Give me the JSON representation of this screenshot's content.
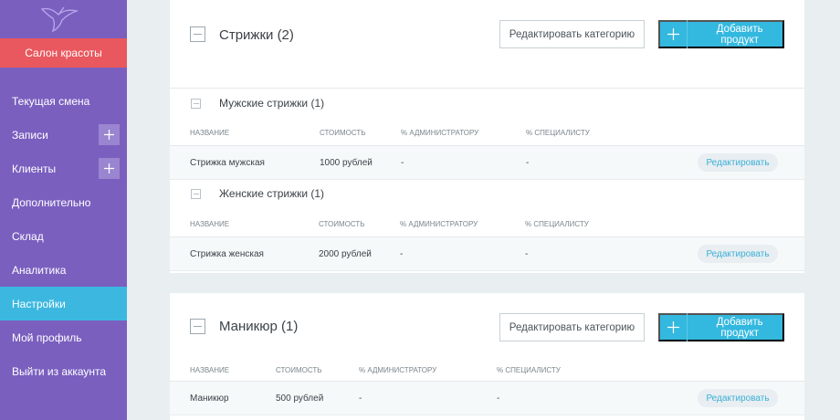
{
  "sidebar": {
    "salon_label": "Салон красоты",
    "items": [
      {
        "label": "Текущая смена",
        "has_plus": false,
        "active": false
      },
      {
        "label": "Записи",
        "has_plus": true,
        "active": false
      },
      {
        "label": "Клиенты",
        "has_plus": true,
        "active": false
      },
      {
        "label": "Дополнительно",
        "has_plus": false,
        "active": false
      },
      {
        "label": "Склад",
        "has_plus": false,
        "active": false
      },
      {
        "label": "Аналитика",
        "has_plus": false,
        "active": false
      },
      {
        "label": "Настройки",
        "has_plus": false,
        "active": true
      },
      {
        "label": "Мой профиль",
        "has_plus": false,
        "active": false
      },
      {
        "label": "Выйти из аккаунта",
        "has_plus": false,
        "active": false
      }
    ]
  },
  "colors": {
    "sidebar": "#7a5fbf",
    "salon": "#e9585e",
    "active": "#3cb8e0",
    "accent": "#33b8df"
  },
  "common": {
    "edit_category": "Редактировать категорию",
    "add_product": "Добавить продукт",
    "edit": "Редактировать",
    "col_name": "Название",
    "col_price": "Стоимость",
    "col_admin": "% администратору",
    "col_specialist": "% специалисту"
  },
  "categories": [
    {
      "title": "Стрижки (2)",
      "subcategories": [
        {
          "title": "Мужские стрижки (1)",
          "rows": [
            {
              "name": "Стрижка мужская",
              "price": "1000 рублей",
              "admin": "-",
              "specialist": "-"
            }
          ]
        },
        {
          "title": "Женские стрижки (1)",
          "rows": [
            {
              "name": "Стрижка женская",
              "price": "2000 рублей",
              "admin": "-",
              "specialist": "-"
            }
          ]
        }
      ]
    },
    {
      "title": "Маникюр (1)",
      "rows": [
        {
          "name": "Маникюр",
          "price": "500 рублей",
          "admin": "-",
          "specialist": "-"
        }
      ]
    }
  ],
  "icons": {
    "logo": "hummingbird-logo-icon",
    "collapse": "minus-square-icon",
    "plus": "plus-icon"
  }
}
